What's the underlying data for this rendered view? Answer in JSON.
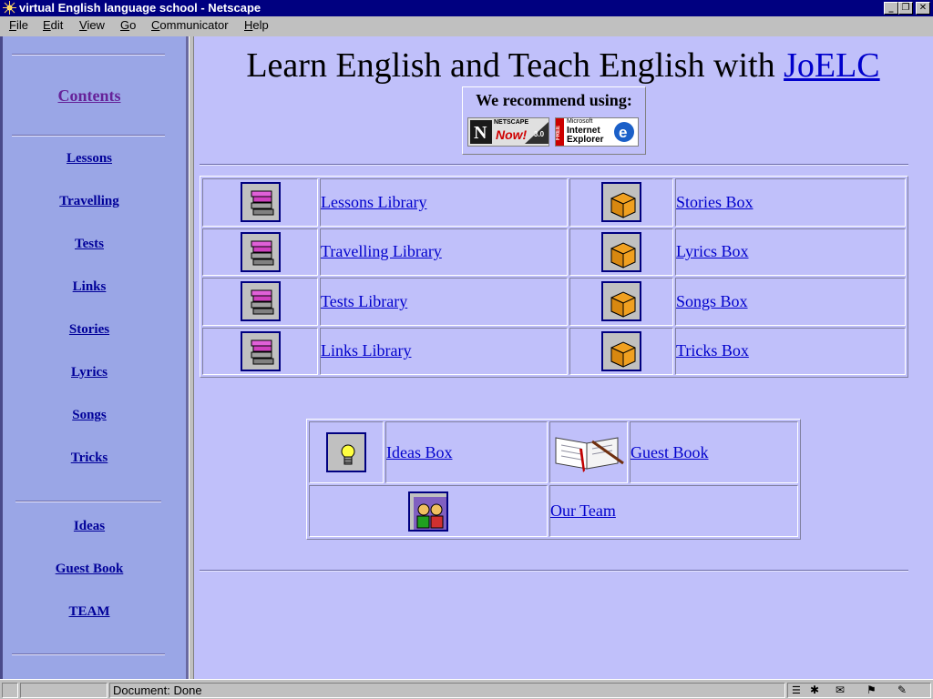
{
  "window": {
    "title": "virtual English language school - Netscape",
    "controls": [
      "_",
      "❐",
      "✕"
    ]
  },
  "menu": [
    "File",
    "Edit",
    "View",
    "Go",
    "Communicator",
    "Help"
  ],
  "sidebar": {
    "heading": "Contents",
    "primary_links": [
      "Lessons",
      "Travelling",
      "Tests",
      "Links",
      "Stories",
      "Lyrics",
      "Songs",
      "Tricks"
    ],
    "secondary_links": [
      "Ideas",
      "Guest Book",
      "TEAM"
    ]
  },
  "main": {
    "headline_prefix": "Learn English and Teach English with",
    "headline_link": "JoELC",
    "recommend_label": "We recommend using:",
    "netscape_badge": {
      "line1": "NETSCAPE",
      "line2": "Now!",
      "version": "3.0"
    },
    "ie_badge": {
      "line1": "Microsoft",
      "line2": "Internet",
      "line3": "Explorer",
      "side": "FREE"
    },
    "libraries": [
      "Lessons Library",
      "Travelling Library",
      "Tests Library",
      "Links Library"
    ],
    "boxes": [
      "Stories Box",
      "Lyrics Box",
      "Songs Box",
      "Tricks Box"
    ],
    "extras": {
      "ideas": "Ideas Box",
      "guestbook": "Guest Book",
      "team": "Our Team"
    }
  },
  "status": {
    "text": "Document: Done"
  },
  "icons": [
    "netscape-logo-icon",
    "books-icon",
    "box-icon",
    "lightbulb-icon",
    "open-book-icon",
    "team-icon",
    "security-lock-icon"
  ]
}
